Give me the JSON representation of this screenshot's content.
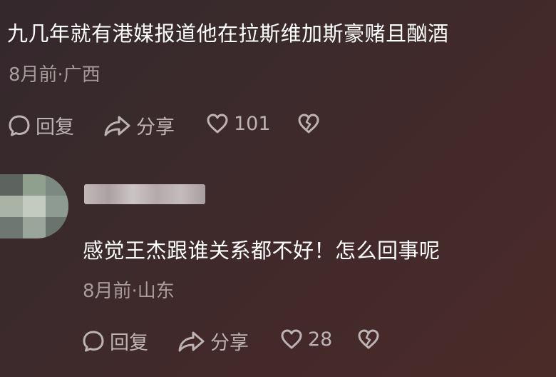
{
  "comments": [
    {
      "text": "九几年就有港媒报道他在拉斯维加斯豪赌且酗酒",
      "time_location": "8月前·广西",
      "reply_label": "回复",
      "share_label": "分享",
      "like_count": "101"
    },
    {
      "text": "感觉王杰跟谁关系都不好！怎么回事呢",
      "time_location": "8月前·山东",
      "reply_label": "回复",
      "share_label": "分享",
      "like_count": "28"
    }
  ],
  "colors": {
    "background": "#3b2a2c",
    "text": "#ffffff",
    "meta": "#a79b9c",
    "action": "#bdb3b4"
  },
  "icons": {
    "reply": "speech-bubble-icon",
    "share": "share-arrow-icon",
    "like": "heart-icon",
    "dislike": "broken-heart-icon"
  }
}
